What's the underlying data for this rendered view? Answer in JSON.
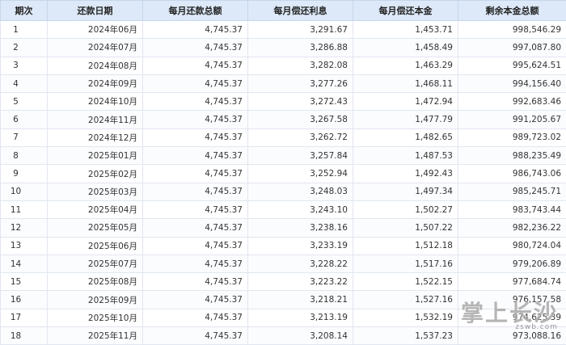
{
  "table": {
    "headers": [
      "期次",
      "还款日期",
      "每月还款总额",
      "每月偿还利息",
      "每月偿还本金",
      "剩余本金总额"
    ],
    "rows": [
      [
        "1",
        "2024年06月",
        "4,745.37",
        "3,291.67",
        "1,453.71",
        "998,546.29"
      ],
      [
        "2",
        "2024年07月",
        "4,745.37",
        "3,286.88",
        "1,458.49",
        "997,087.80"
      ],
      [
        "3",
        "2024年08月",
        "4,745.37",
        "3,282.08",
        "1,463.29",
        "995,624.51"
      ],
      [
        "4",
        "2024年09月",
        "4,745.37",
        "3,277.26",
        "1,468.11",
        "994,156.40"
      ],
      [
        "5",
        "2024年10月",
        "4,745.37",
        "3,272.43",
        "1,472.94",
        "992,683.46"
      ],
      [
        "6",
        "2024年11月",
        "4,745.37",
        "3,267.58",
        "1,477.79",
        "991,205.67"
      ],
      [
        "7",
        "2024年12月",
        "4,745.37",
        "3,262.72",
        "1,482.65",
        "989,723.02"
      ],
      [
        "8",
        "2025年01月",
        "4,745.37",
        "3,257.84",
        "1,487.53",
        "988,235.49"
      ],
      [
        "9",
        "2025年02月",
        "4,745.37",
        "3,252.94",
        "1,492.43",
        "986,743.06"
      ],
      [
        "10",
        "2025年03月",
        "4,745.37",
        "3,248.03",
        "1,497.34",
        "985,245.71"
      ],
      [
        "11",
        "2025年04月",
        "4,745.37",
        "3,243.10",
        "1,502.27",
        "983,743.44"
      ],
      [
        "12",
        "2025年05月",
        "4,745.37",
        "3,238.16",
        "1,507.22",
        "982,236.22"
      ],
      [
        "13",
        "2025年06月",
        "4,745.37",
        "3,233.19",
        "1,512.18",
        "980,724.04"
      ],
      [
        "14",
        "2025年07月",
        "4,745.37",
        "3,228.22",
        "1,517.16",
        "979,206.89"
      ],
      [
        "15",
        "2025年08月",
        "4,745.37",
        "3,223.22",
        "1,522.15",
        "977,684.74"
      ],
      [
        "16",
        "2025年09月",
        "4,745.37",
        "3,218.21",
        "1,527.16",
        "976,157.58"
      ],
      [
        "17",
        "2025年10月",
        "4,745.37",
        "3,213.19",
        "1,532.19",
        "974,625.39"
      ],
      [
        "18",
        "2025年11月",
        "4,745.37",
        "3,208.14",
        "1,537.23",
        "973,088.16"
      ]
    ]
  },
  "watermark": {
    "main": "掌上长沙",
    "sub": "zswb.com"
  }
}
